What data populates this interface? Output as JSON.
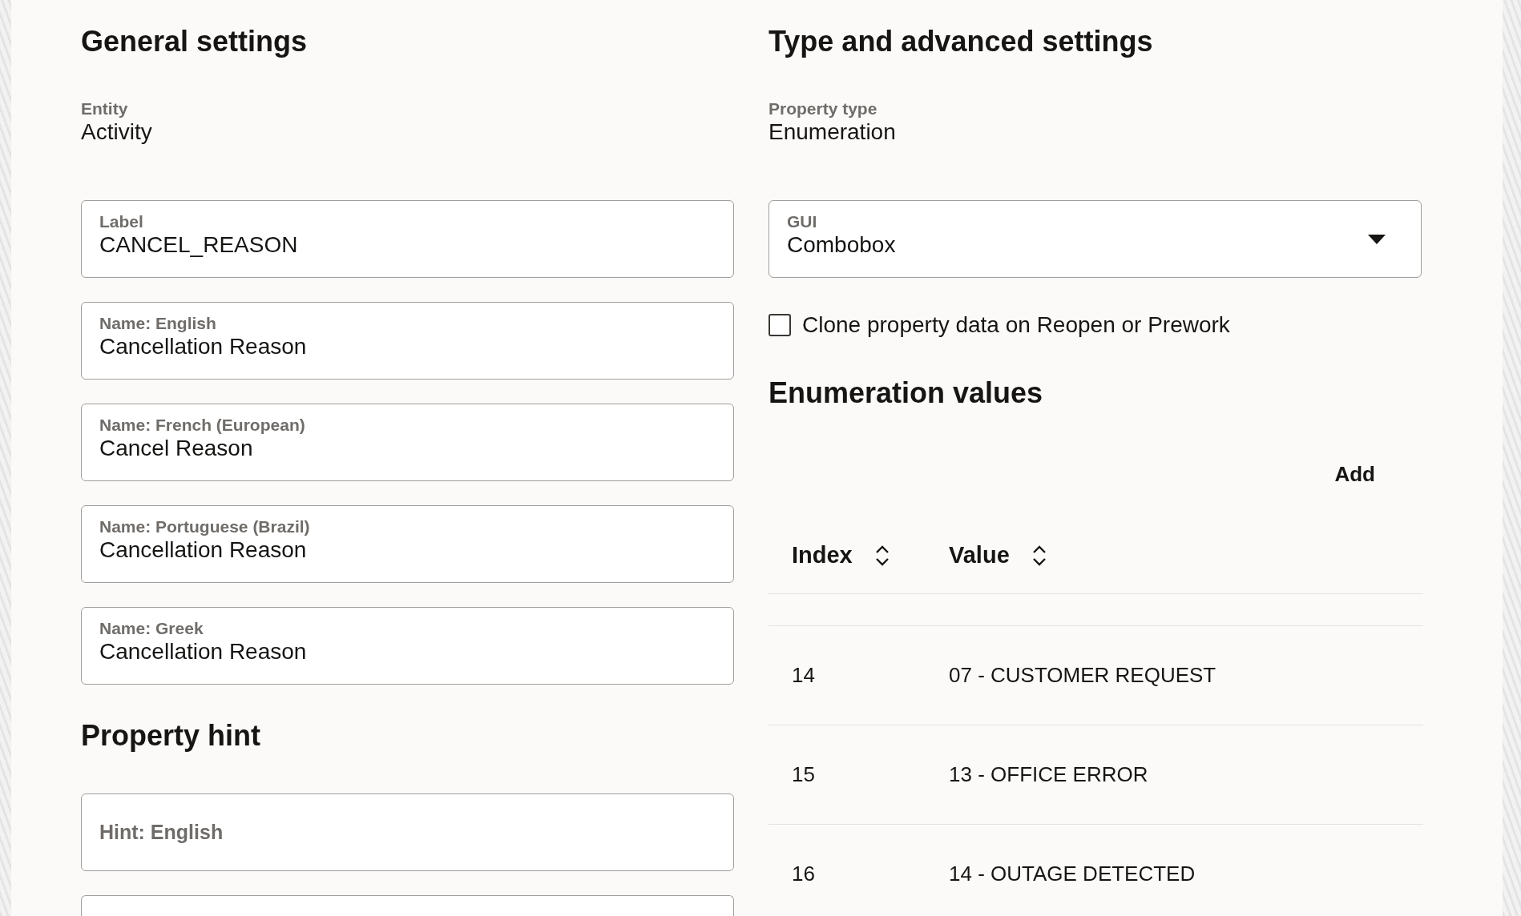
{
  "general": {
    "title": "General settings",
    "entity": {
      "label": "Entity",
      "value": "Activity"
    },
    "fields": [
      {
        "label": "Label",
        "value": "CANCEL_REASON"
      },
      {
        "label": "Name: English",
        "value": "Cancellation Reason"
      },
      {
        "label": "Name: French (European)",
        "value": "Cancel Reason"
      },
      {
        "label": "Name: Portuguese (Brazil)",
        "value": "Cancellation Reason"
      },
      {
        "label": "Name: Greek",
        "value": "Cancellation Reason"
      }
    ]
  },
  "hint": {
    "title": "Property hint",
    "fields": [
      {
        "kind": "full",
        "placeholder": "Hint: English"
      },
      {
        "kind": "partial"
      }
    ]
  },
  "type_settings": {
    "title": "Type and advanced settings",
    "property_type": {
      "label": "Property type",
      "value": "Enumeration"
    },
    "gui": {
      "label": "GUI",
      "value": "Combobox"
    },
    "clone_checkbox": {
      "label": "Clone property data on Reopen or Prework",
      "checked": false
    }
  },
  "enumeration": {
    "title": "Enumeration values",
    "add_button": "Add",
    "table": {
      "columns": [
        "Index",
        "Value"
      ],
      "rows": [
        [
          "14",
          "07 - CUSTOMER REQUEST"
        ],
        [
          "15",
          "13 - OFFICE ERROR"
        ],
        [
          "16",
          "14 - OUTAGE DETECTED"
        ]
      ]
    }
  }
}
